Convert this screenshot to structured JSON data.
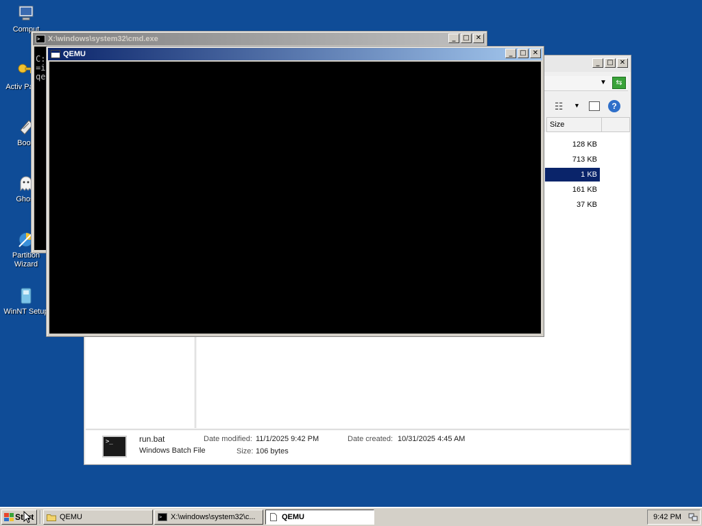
{
  "desktop": {
    "icons": [
      {
        "label": "Comput",
        "icon": "computer-icon"
      },
      {
        "label": "Activ Passw",
        "icon": "key-icon"
      },
      {
        "label": "BootI",
        "icon": "boot-tool-icon"
      },
      {
        "label": "Ghost",
        "icon": "ghost-icon"
      },
      {
        "label": "Partition Wizard",
        "icon": "partition-wizard-icon"
      },
      {
        "label": "WinNT Setup",
        "icon": "setup-icon"
      }
    ]
  },
  "cmd_window": {
    "title": "X:\\windows\\system32\\cmd.exe",
    "console_lines": [
      "C:",
      "=i",
      "qe"
    ]
  },
  "qemu_window": {
    "title": "QEMU"
  },
  "explorer": {
    "columns": {
      "size": "Size"
    },
    "rows": [
      {
        "size": "128 KB",
        "selected": false
      },
      {
        "size": "713 KB",
        "selected": false
      },
      {
        "size": "1 KB",
        "selected": true
      },
      {
        "size": "161 KB",
        "selected": false
      },
      {
        "size": "37 KB",
        "selected": false
      }
    ],
    "details": {
      "name": "run.bat",
      "type": "Windows Batch File",
      "modified_label": "Date modified:",
      "modified_value": "11/1/2025 9:42 PM",
      "created_label": "Date created:",
      "created_value": "10/31/2025 4:45 AM",
      "size_label": "Size:",
      "size_value": "106 bytes"
    }
  },
  "taskbar": {
    "start_label": "Start",
    "tasks": [
      {
        "label": "QEMU",
        "icon": "folder-icon",
        "active": false
      },
      {
        "label": "X:\\windows\\system32\\c...",
        "icon": "console-icon",
        "active": false
      },
      {
        "label": "QEMU",
        "icon": "document-icon",
        "active": true
      }
    ],
    "clock": "9:42 PM"
  },
  "colors": {
    "desktop": "#0f4c97",
    "active_title_start": "#0a246a",
    "active_title_end": "#a6caf0",
    "selection": "#0a246a"
  }
}
